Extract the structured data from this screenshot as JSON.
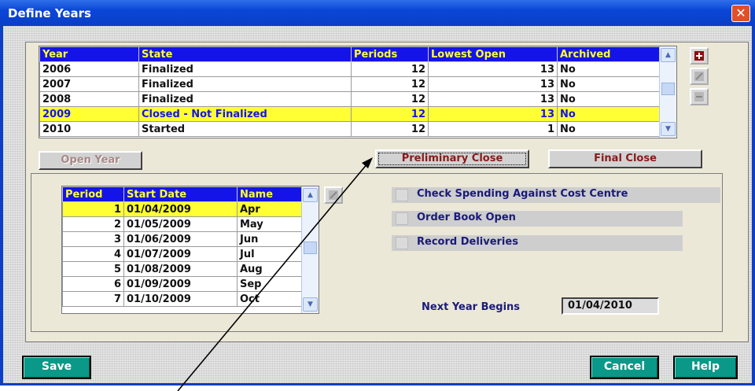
{
  "window": {
    "title": "Define Years",
    "close_glyph": "✕"
  },
  "years_table": {
    "columns": [
      "Year",
      "State",
      "Periods",
      "Lowest Open",
      "Archived"
    ],
    "rows": [
      {
        "year": "2006",
        "state": "Finalized",
        "periods": "12",
        "lowest_open": "13",
        "archived": "No",
        "selected": false
      },
      {
        "year": "2007",
        "state": "Finalized",
        "periods": "12",
        "lowest_open": "13",
        "archived": "No",
        "selected": false
      },
      {
        "year": "2008",
        "state": "Finalized",
        "periods": "12",
        "lowest_open": "13",
        "archived": "No",
        "selected": false
      },
      {
        "year": "2009",
        "state": "Closed - Not Finalized",
        "periods": "12",
        "lowest_open": "13",
        "archived": "No",
        "selected": true
      },
      {
        "year": "2010",
        "state": "Started",
        "periods": "12",
        "lowest_open": "1",
        "archived": "No",
        "selected": false
      }
    ]
  },
  "side_buttons": {
    "add": "plus-icon",
    "edit": "pencil-icon",
    "remove": "minus-icon"
  },
  "actions": {
    "open_year": "Open Year",
    "preliminary_close": "Preliminary Close",
    "final_close": "Final Close"
  },
  "periods_table": {
    "columns": [
      "Period",
      "Start Date",
      "Name"
    ],
    "rows": [
      {
        "period": "1",
        "start_date": "01/04/2009",
        "name": "Apr",
        "selected": true
      },
      {
        "period": "2",
        "start_date": "01/05/2009",
        "name": "May",
        "selected": false
      },
      {
        "period": "3",
        "start_date": "01/06/2009",
        "name": "Jun",
        "selected": false
      },
      {
        "period": "4",
        "start_date": "01/07/2009",
        "name": "Jul",
        "selected": false
      },
      {
        "period": "5",
        "start_date": "01/08/2009",
        "name": "Aug",
        "selected": false
      },
      {
        "period": "6",
        "start_date": "01/09/2009",
        "name": "Sep",
        "selected": false
      },
      {
        "period": "7",
        "start_date": "01/10/2009",
        "name": "Oct",
        "selected": false
      }
    ]
  },
  "options": {
    "check_spending": {
      "label": "Check Spending Against Cost Centre",
      "checked": false
    },
    "order_book_open": {
      "label": "Order Book Open",
      "checked": false
    },
    "record_deliveries": {
      "label": "Record Deliveries",
      "checked": false
    }
  },
  "next_year": {
    "label": "Next Year Begins",
    "value": "01/04/2010"
  },
  "footer": {
    "save": "Save",
    "cancel": "Cancel",
    "help": "Help"
  },
  "colors": {
    "header_bg": "#1414e8",
    "header_text": "#ffff33",
    "selected_row_bg": "#ffff33",
    "selected_row_text": "#1414e8",
    "title_bar": "#0a3fc6",
    "footer_button": "#0a9888",
    "action_text": "#8a1a1a",
    "label_text": "#1a1a7a"
  }
}
